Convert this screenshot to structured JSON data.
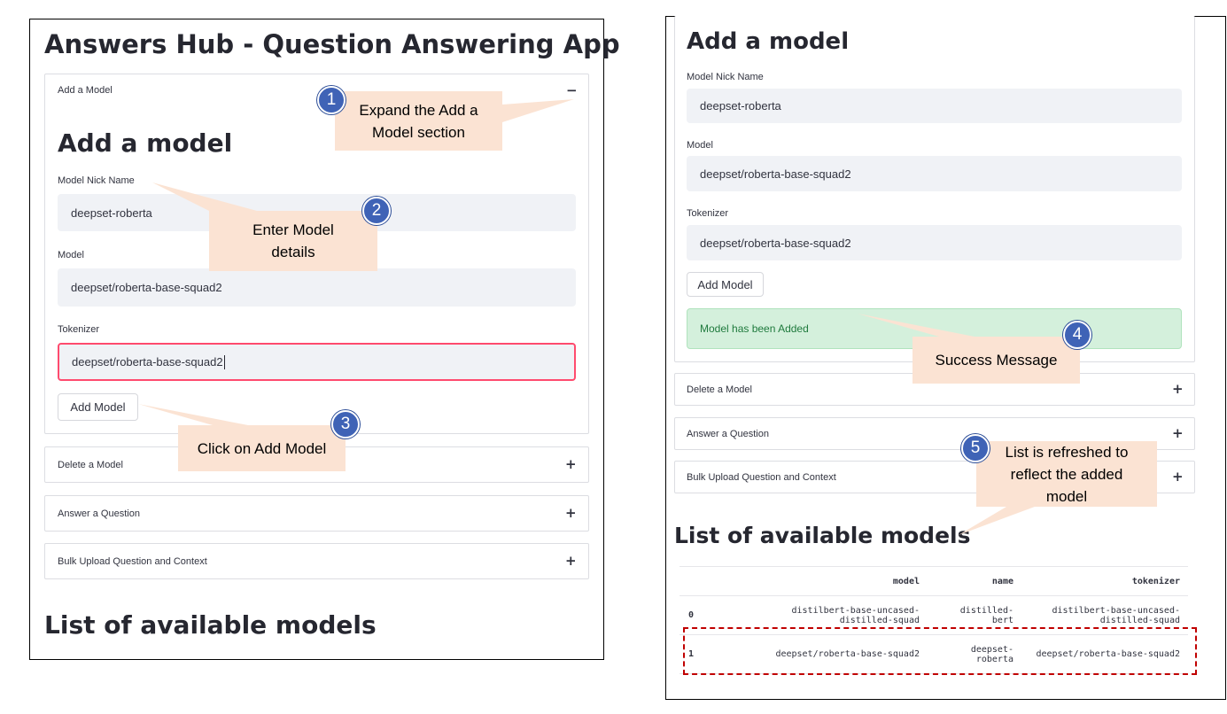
{
  "left_panel": {
    "app_title": "Answers Hub - Question Answering App",
    "add_expander": {
      "label": "Add a Model",
      "toggle": "−"
    },
    "section_title": "Add a model",
    "nick_label": "Model Nick Name",
    "nick_value": "deepset-roberta",
    "model_label": "Model",
    "model_value": "deepset/roberta-base-squad2",
    "tokenizer_label": "Tokenizer",
    "tokenizer_value": "deepset/roberta-base-squad2",
    "add_button": "Add Model",
    "expanders": [
      {
        "label": "Delete a Model",
        "toggle": "+"
      },
      {
        "label": "Answer a Question",
        "toggle": "+"
      },
      {
        "label": "Bulk Upload Question and Context",
        "toggle": "+"
      }
    ],
    "list_title": "List of available models"
  },
  "right_panel": {
    "section_title": "Add a model",
    "nick_label": "Model Nick Name",
    "nick_value": "deepset-roberta",
    "model_label": "Model",
    "model_value": "deepset/roberta-base-squad2",
    "tokenizer_label": "Tokenizer",
    "tokenizer_value": "deepset/roberta-base-squad2",
    "add_button": "Add Model",
    "success_message": "Model has been Added",
    "expanders": [
      {
        "label": "Delete a Model",
        "toggle": "+"
      },
      {
        "label": "Answer a Question",
        "toggle": "+"
      },
      {
        "label": "Bulk Upload Question and Context",
        "toggle": "+"
      }
    ],
    "list_title": "List of available models",
    "table": {
      "columns": [
        "",
        "model",
        "name",
        "tokenizer"
      ],
      "rows": [
        {
          "index": "0",
          "model_line1": "distilbert-base-uncased-",
          "model_line2": "distilled-squad",
          "name_line1": "distilled-",
          "name_line2": "bert",
          "tokenizer_line1": "distilbert-base-uncased-",
          "tokenizer_line2": "distilled-squad"
        },
        {
          "index": "1",
          "model_line1": "deepset/roberta-base-squad2",
          "model_line2": "",
          "name_line1": "deepset-",
          "name_line2": "roberta",
          "tokenizer_line1": "deepset/roberta-base-squad2",
          "tokenizer_line2": ""
        }
      ]
    }
  },
  "callouts": [
    {
      "number": "1",
      "line1": "Expand the Add a",
      "line2": "Model section"
    },
    {
      "number": "2",
      "line1": "Enter Model",
      "line2": "details"
    },
    {
      "number": "3",
      "line1": "Click on Add Model",
      "line2": ""
    },
    {
      "number": "4",
      "line1": "Success Message",
      "line2": ""
    },
    {
      "number": "5",
      "line1": "List is refreshed to",
      "line2": "reflect the added",
      "line3": "model"
    }
  ],
  "colors": {
    "callout_fill": "#fbe3d3",
    "badge_fill": "#3f63b6",
    "focus_border": "#ff4b6e",
    "success_fill": "#d4f0dc",
    "highlight_dash": "#c00000"
  }
}
